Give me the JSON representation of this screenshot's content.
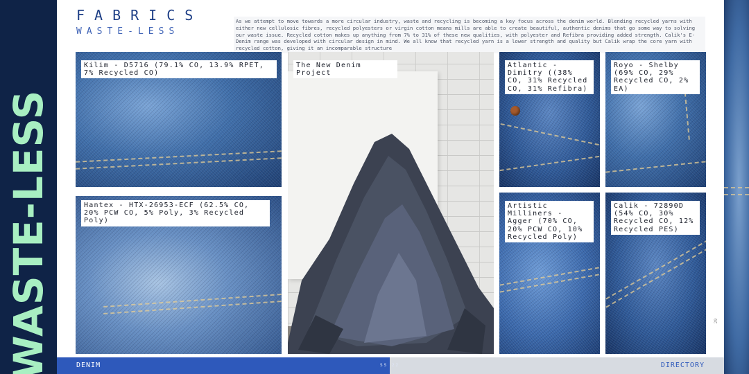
{
  "side_title": "WASTE-LESS",
  "header": {
    "kicker": "FABRICS",
    "subkicker": "WASTE-LESS",
    "intro": "As we attempt to move towards a more circular industry, waste and recycling is becoming a key focus across the denim world. Blending recycled yarns with either new cellulosic fibres, recycled polyesters or virgin cotton means mills are able to create beautiful, authentic denims that go some way to solving our waste issue. Recycled cotton makes up anything from 7% to 31% of these new qualities, with polyester and Refibra providing added strength. Calik's E-Denim range was developed with circular design in mind. We all know that recycled yarn is a lower strength and quality but Calik wrap the core yarn with recycled cotton, giving it an incomparable structure"
  },
  "fabrics": [
    {
      "label": "Kilim - D5716 (79.1% CO, 13.9% RPET, 7% Recycled CO)"
    },
    {
      "label": "Hantex - HTX-26953-ECF (62.5% CO, 20% PCW CO, 5% Poly, 3% Recycled Poly)"
    },
    {
      "label": "The New Denim Project"
    },
    {
      "label": "Atlantic - Dimitry ((38% CO, 31% Recycled CO, 31% Refibra)"
    },
    {
      "label": "Royo - Shelby (69% CO, 29% Recycled CO, 2% EA)"
    },
    {
      "label": "Artistic Milliners - Agger (70% CO, 20% PCW CO, 10% Recycled Poly)"
    },
    {
      "label": "Calik - 72890D (54% CO, 30% Recycled CO, 12% Recycled PES)"
    }
  ],
  "page_number": "29",
  "footer": {
    "left": "DENIM",
    "middle": "SS 22",
    "right": "DIRECTORY"
  },
  "colors": {
    "navy": "#0f2347",
    "mint": "#a8efc2",
    "accent_blue": "#2e59bb"
  }
}
